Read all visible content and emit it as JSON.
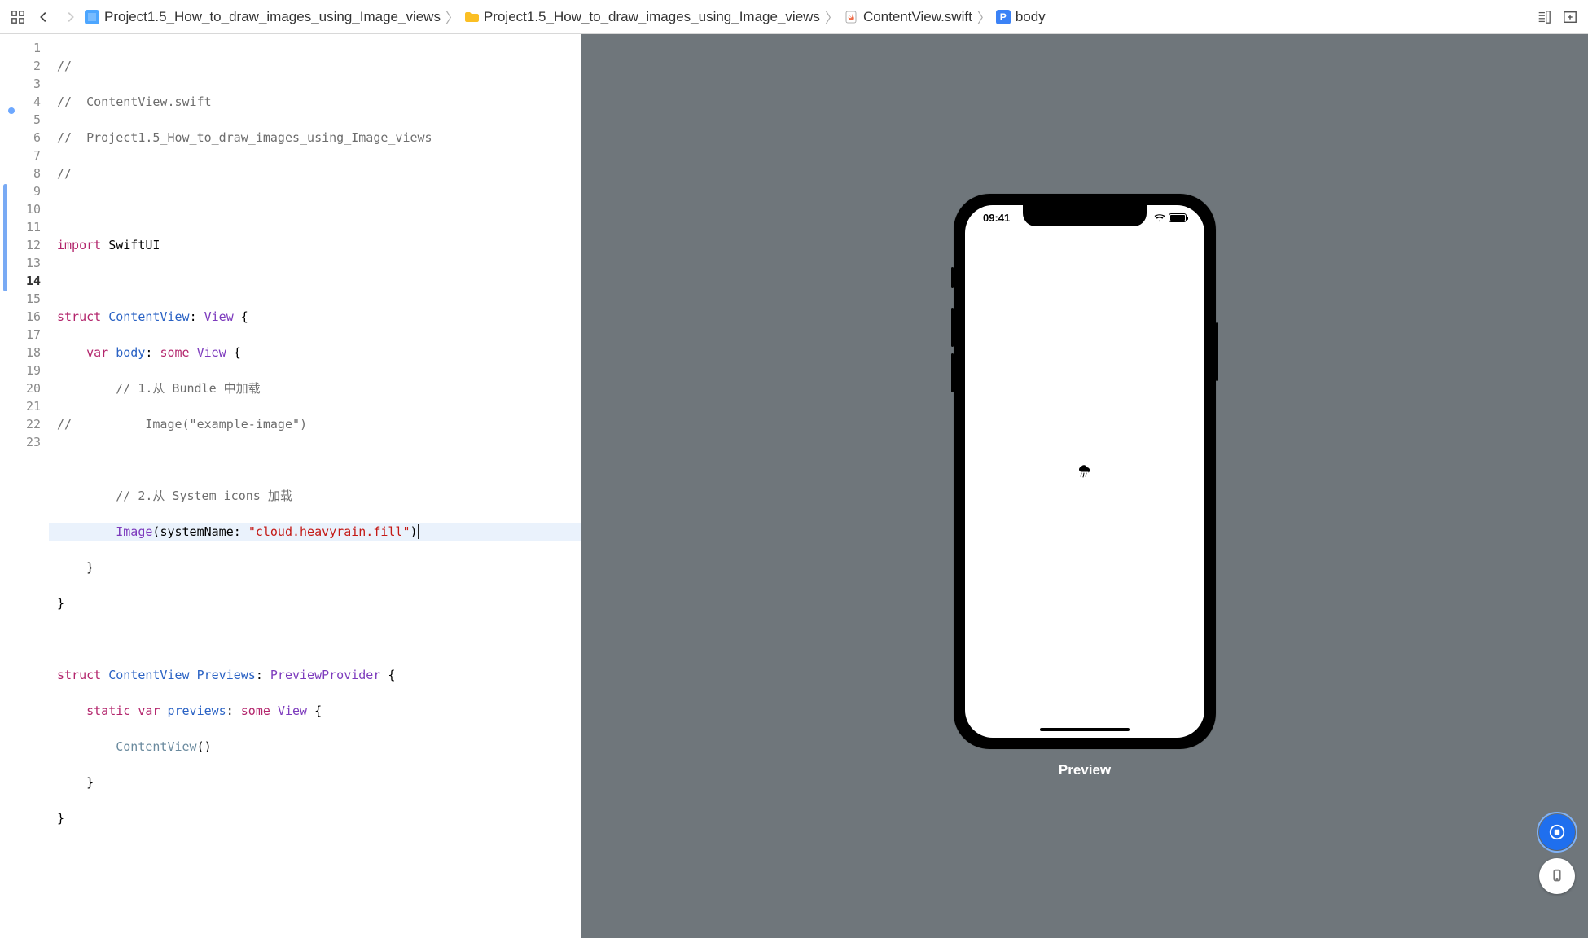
{
  "breadcrumb": {
    "items": [
      {
        "label": "Project1.5_How_to_draw_images_using_Image_views"
      },
      {
        "label": "Project1.5_How_to_draw_images_using_Image_views"
      },
      {
        "label": "ContentView.swift"
      },
      {
        "label": "body"
      }
    ]
  },
  "editor": {
    "current_line": 14,
    "modified_ranges": [
      [
        9,
        14
      ]
    ],
    "lines": [
      {
        "n": 1,
        "t": "//"
      },
      {
        "n": 2,
        "t": "//  ContentView.swift"
      },
      {
        "n": 3,
        "t": "//  Project1.5_How_to_draw_images_using_Image_views"
      },
      {
        "n": 4,
        "t": "//"
      },
      {
        "n": 5,
        "t": ""
      },
      {
        "n": 6,
        "t": "import SwiftUI"
      },
      {
        "n": 7,
        "t": ""
      },
      {
        "n": 8,
        "t": "struct ContentView: View {"
      },
      {
        "n": 9,
        "t": "    var body: some View {"
      },
      {
        "n": 10,
        "t": "        // 1.从 Bundle 中加载"
      },
      {
        "n": 11,
        "t": "//          Image(\"example-image\")"
      },
      {
        "n": 12,
        "t": ""
      },
      {
        "n": 13,
        "t": "        // 2.从 System icons 加载"
      },
      {
        "n": 14,
        "t": "        Image(systemName: \"cloud.heavyrain.fill\")"
      },
      {
        "n": 15,
        "t": "    }"
      },
      {
        "n": 16,
        "t": "}"
      },
      {
        "n": 17,
        "t": ""
      },
      {
        "n": 18,
        "t": "struct ContentView_Previews: PreviewProvider {"
      },
      {
        "n": 19,
        "t": "    static var previews: some View {"
      },
      {
        "n": 20,
        "t": "        ContentView()"
      },
      {
        "n": 21,
        "t": "    }"
      },
      {
        "n": 22,
        "t": "}"
      },
      {
        "n": 23,
        "t": ""
      }
    ],
    "tokens": {
      "import": "import",
      "swiftui": "SwiftUI",
      "struct": "struct",
      "cv": "ContentView",
      "view": "View",
      "var": "var",
      "body": "body",
      "some": "some",
      "image": "Image",
      "sysname": "systemName:",
      "strCloud": "\"cloud.heavyrain.fill\"",
      "cvp": "ContentView_Previews",
      "pp": "PreviewProvider",
      "static": "static",
      "previews": "previews",
      "cvCall": "ContentView",
      "c1": "//",
      "c2": "//  ContentView.swift",
      "c3": "//  Project1.5_How_to_draw_images_using_Image_views",
      "c4": "//",
      "c10": "// 1.从 Bundle 中加载",
      "c11": "//          Image(\"example-image\")",
      "c13": "// 2.从 System icons 加载"
    }
  },
  "preview": {
    "label": "Preview",
    "status_time": "09:41",
    "content_symbol": "cloud.heavyrain.fill"
  }
}
